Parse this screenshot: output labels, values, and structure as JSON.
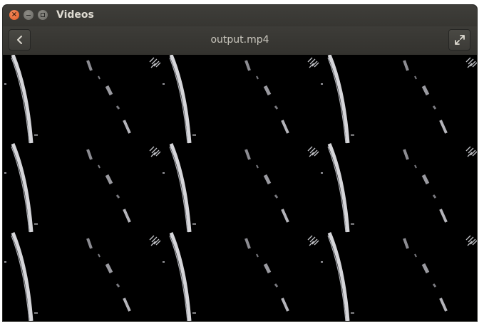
{
  "window": {
    "app_title": "Videos",
    "controls": {
      "close_icon": "close-icon",
      "minimize_icon": "minimize-icon",
      "maximize_icon": "maximize-icon"
    }
  },
  "header": {
    "back_icon": "chevron-left-icon",
    "file_title": "output.mp4",
    "fullscreen_icon": "fullscreen-icon"
  },
  "video": {
    "content": "tiled 3x3 black-and-white lane-detection output frames"
  },
  "colors": {
    "titlebar": "#3b3a36",
    "close_button": "#e9612f",
    "video_background": "#000000",
    "lane_marking": "#d4d4d8"
  }
}
